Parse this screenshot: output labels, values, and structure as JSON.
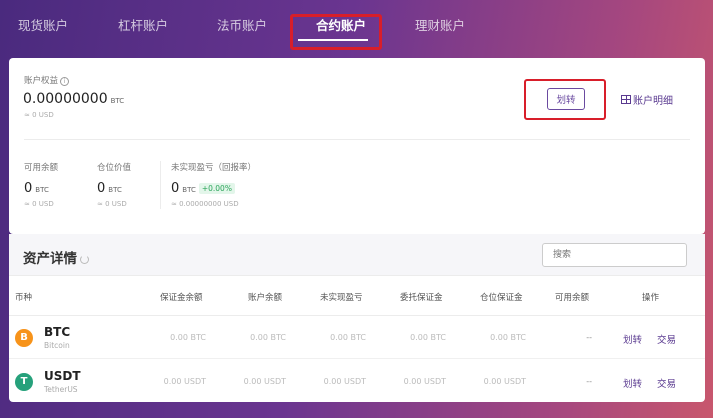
{
  "tabs": [
    {
      "label": "现货账户"
    },
    {
      "label": "杠杆账户"
    },
    {
      "label": "法币账户"
    },
    {
      "label": "合约账户"
    },
    {
      "label": "理财账户"
    }
  ],
  "overview": {
    "equity_label": "账户权益",
    "info_glyph": "i",
    "equity_value": "0.00000000",
    "equity_unit": "BTC",
    "equity_usd": "≈ 0 USD",
    "transfer_label": "划转",
    "detail_label": "账户明细",
    "stats": [
      {
        "label": "可用余额",
        "value": "0",
        "unit": "BTC",
        "usd": "≈ 0 USD"
      },
      {
        "label": "仓位价值",
        "value": "0",
        "unit": "BTC",
        "usd": "≈ 0 USD"
      },
      {
        "label": "未实现盈亏（回报率）",
        "value": "0",
        "unit": "BTC",
        "badge": "+0.00%",
        "usd": "≈ 0.00000000 USD"
      }
    ]
  },
  "assets": {
    "title": "资产详情",
    "search_placeholder": "搜索",
    "columns": [
      "币种",
      "保证金余额",
      "账户余额",
      "未实现盈亏",
      "委托保证金",
      "仓位保证金",
      "可用余额",
      "操作"
    ],
    "rows": [
      {
        "symbol": "BTC",
        "name": "Bitcoin",
        "icon": "bitcoin-icon",
        "icon_glyph": "B",
        "icon_color": "#f7931a",
        "cells": [
          "0.00  BTC",
          "0.00  BTC",
          "0.00  BTC",
          "0.00  BTC",
          "0.00  BTC",
          "--"
        ],
        "actions": [
          "划转",
          "交易"
        ]
      },
      {
        "symbol": "USDT",
        "name": "TetherUS",
        "icon": "tether-icon",
        "icon_glyph": "T",
        "icon_color": "#26a17b",
        "cells": [
          "0.00  USDT",
          "0.00  USDT",
          "0.00  USDT",
          "0.00  USDT",
          "0.00  USDT",
          "--"
        ],
        "actions": [
          "划转",
          "交易"
        ]
      }
    ]
  },
  "colors": {
    "accent": "#5a3a90",
    "highlight": "#d81e2a",
    "positive": "#2ba45a"
  }
}
